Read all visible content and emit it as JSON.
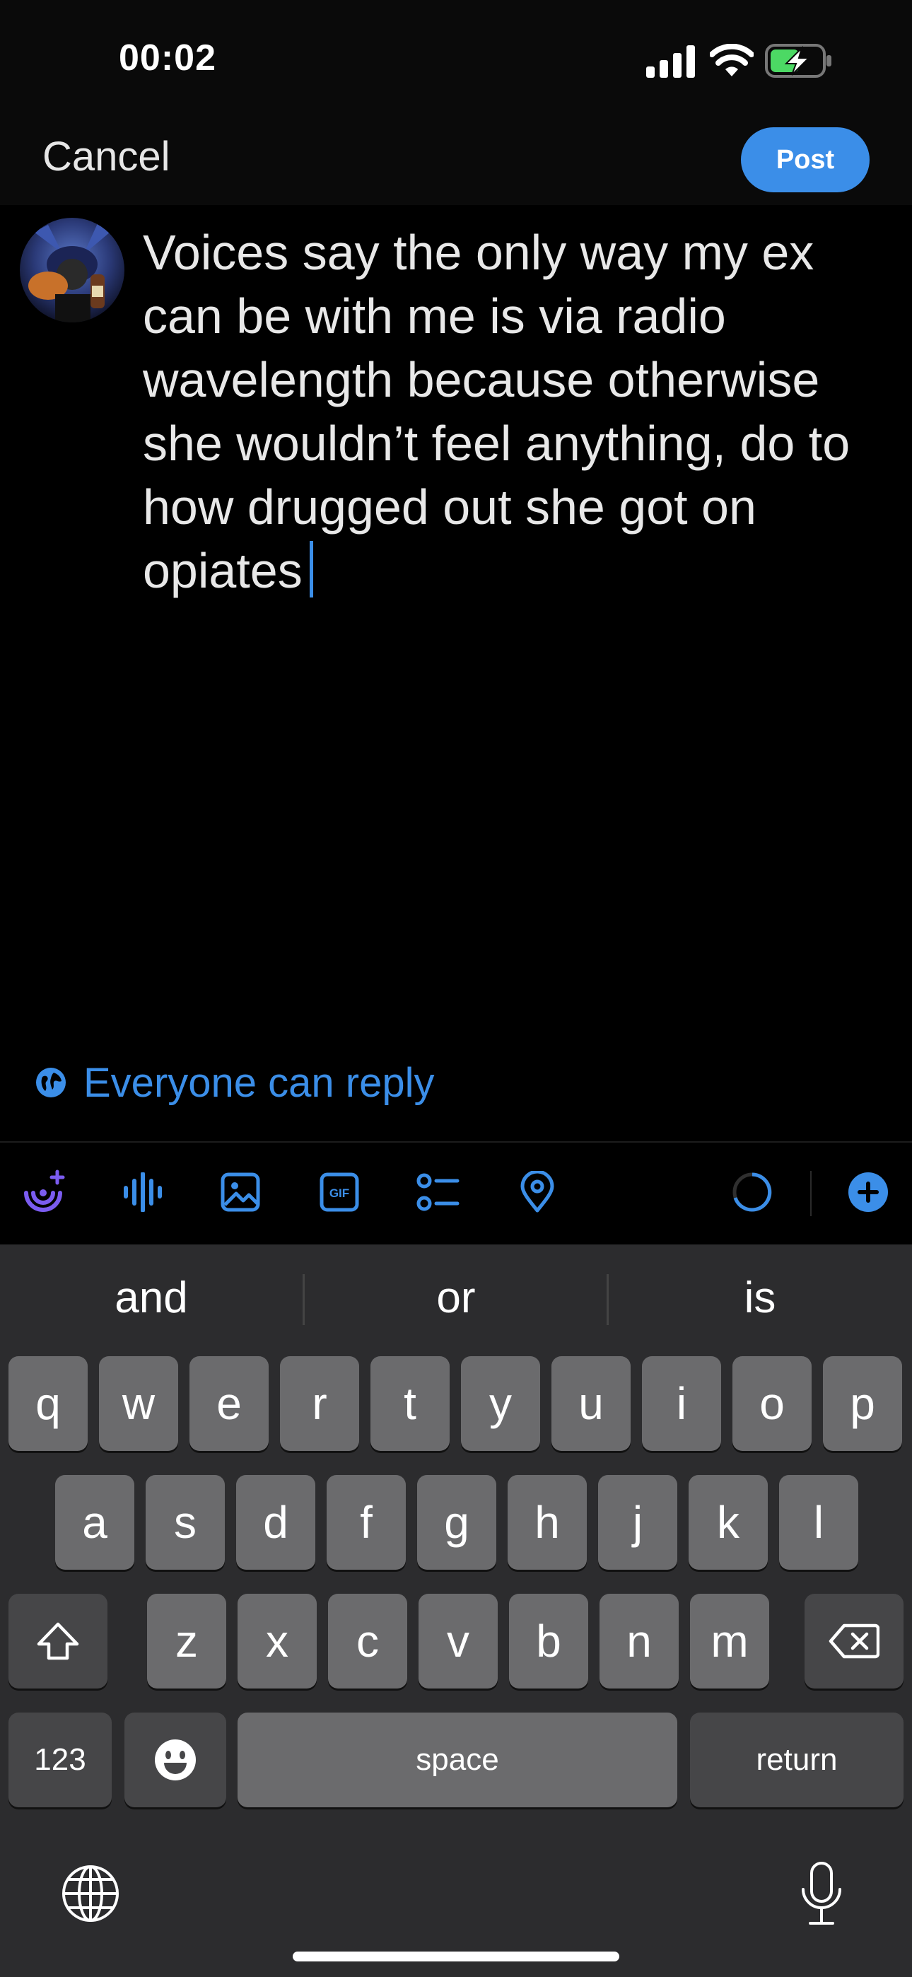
{
  "status_bar": {
    "time": "00:02"
  },
  "header": {
    "cancel_label": "Cancel",
    "post_label": "Post"
  },
  "composer": {
    "text": "Voices say the only way my ex can be with me is via radio wavelength because otherwise she wouldn’t feel anything, do to how drugged out she got on opiates"
  },
  "reply_setting": {
    "label": "Everyone can reply",
    "icon": "globe-icon"
  },
  "toolbar": {
    "icons": [
      "add-voice-icon",
      "audio-waveform-icon",
      "image-icon",
      "gif-icon",
      "poll-icon",
      "location-icon",
      "character-count-ring-icon",
      "add-thread-icon"
    ],
    "gif_text": "GIF"
  },
  "keyboard": {
    "suggestions": [
      "and",
      "or",
      "is"
    ],
    "row1": [
      "q",
      "w",
      "e",
      "r",
      "t",
      "y",
      "u",
      "i",
      "o",
      "p"
    ],
    "row2": [
      "a",
      "s",
      "d",
      "f",
      "g",
      "h",
      "j",
      "k",
      "l"
    ],
    "row3": [
      "z",
      "x",
      "c",
      "v",
      "b",
      "n",
      "m"
    ],
    "numbers_label": "123",
    "space_label": "space",
    "return_label": "return"
  },
  "colors": {
    "accent": "#3b8ee8",
    "voice_accent": "#7b5cf0",
    "keyboard_bg": "#2c2c2e",
    "key": "#6b6b6d"
  }
}
